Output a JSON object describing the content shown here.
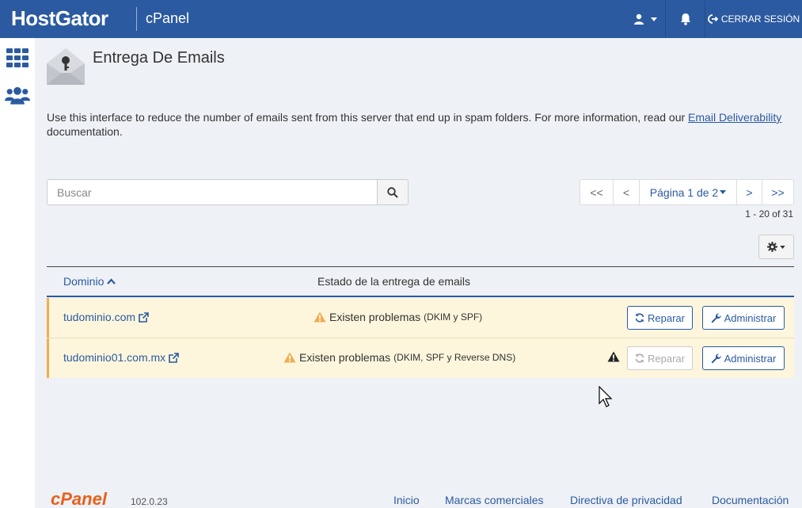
{
  "topbar": {
    "brand": "HostGator",
    "product": "cPanel",
    "logout_label": "CERRAR SESIÓN"
  },
  "icons": {
    "user": "user-icon",
    "caret": "caret-down-icon",
    "bell": "bell-icon",
    "logout": "sign-out-icon",
    "apps": "grid-icon",
    "users": "users-icon",
    "page": "envelope-key-icon",
    "search": "search-icon",
    "gear": "gear-icon",
    "external": "external-link-icon",
    "warning": "warning-icon",
    "refresh": "refresh-icon",
    "wrench": "wrench-icon",
    "sort": "chevron-up-icon"
  },
  "colors": {
    "topbar": "#2b5aa0",
    "link": "#2b5aa0",
    "warning": "#f0ad4e",
    "row_bg": "#fdf6dd",
    "cpanel_orange": "#e8601c"
  },
  "page": {
    "title": "Entrega De Emails",
    "description_before": "Use this interface to reduce the number of emails sent from this server that end up in spam folders. For more information, read our ",
    "description_link": "Email Deliverability",
    "description_after": " documentation."
  },
  "search": {
    "placeholder": "Buscar",
    "value": ""
  },
  "pagination": {
    "first": "<<",
    "prev": "<",
    "page_label": "Página 1 de 2",
    "next": ">",
    "last": ">>",
    "range": "1 - 20 of 31"
  },
  "table": {
    "headers": {
      "domain": "Dominio",
      "status": "Estado de la entrega de emails"
    },
    "rows": [
      {
        "domain": "tudominio.com",
        "status": "Existen problemas",
        "detail": "(DKIM y SPF)",
        "repair": "Reparar",
        "manage": "Administrar"
      },
      {
        "domain": "tudominio01.com.mx",
        "status": "Existen problemas",
        "detail": "(DKIM, SPF y Reverse DNS)",
        "repair": "Reparar",
        "manage": "Administrar"
      }
    ]
  },
  "footer": {
    "logo": "cPanel",
    "version": "102.0.23",
    "links": [
      "Inicio",
      "Marcas comerciales",
      "Directiva de privacidad",
      "Documentación"
    ]
  }
}
